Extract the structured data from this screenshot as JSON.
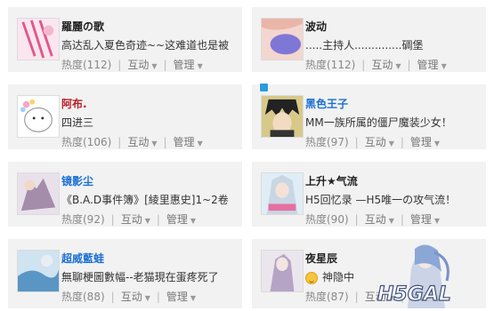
{
  "cards": [
    {
      "name": "羅麗の歌",
      "status": "高达乱入夏色奇迹~~这难道也是被",
      "heat_label": "热度(112)",
      "action_label": "互动",
      "manage_label": "管理"
    },
    {
      "name": "波动",
      "status": ".....主持人..............碉堡",
      "heat_label": "热度(112)",
      "action_label": "互动",
      "manage_label": "管理"
    },
    {
      "name": "阿布.",
      "status": "四进三",
      "heat_label": "热度(106)",
      "action_label": "互动",
      "manage_label": "管理"
    },
    {
      "name": "黑色王子",
      "status": "MM一族所属的僵尸魔装少女！",
      "heat_label": "热度(97)",
      "action_label": "互动",
      "manage_label": "管理"
    },
    {
      "name": "镜影尘",
      "status": "《B.A.D事件簿》[綾里惠史]1~2卷",
      "heat_label": "热度(92)",
      "action_label": "互动",
      "manage_label": "管理"
    },
    {
      "name": "上升★气流",
      "status": "H5回忆录 —H5唯一の攻气流！",
      "heat_label": "热度(90)",
      "action_label": "互动",
      "manage_label": "管理"
    },
    {
      "name": "超威藍蛙",
      "status": "無聊梗圖數幅--老猫現在蛋疼死了",
      "heat_label": "热度(88)",
      "action_label": "互动",
      "manage_label": "管理"
    },
    {
      "name": "夜星辰",
      "status": "神隐中",
      "heat_label": "热度(87)",
      "action_label": "互动",
      "manage_label": "管理"
    }
  ],
  "watermark": {
    "text": "H5GAL"
  },
  "colors": {
    "card_bg": "#f2f2f2",
    "name_red": "#b8202a",
    "name_blue": "#1a6fd4",
    "accent_badge": "#2a9be0"
  },
  "icons": {
    "dropdown": "chevron-down-icon",
    "mood": "smiley-icon"
  }
}
